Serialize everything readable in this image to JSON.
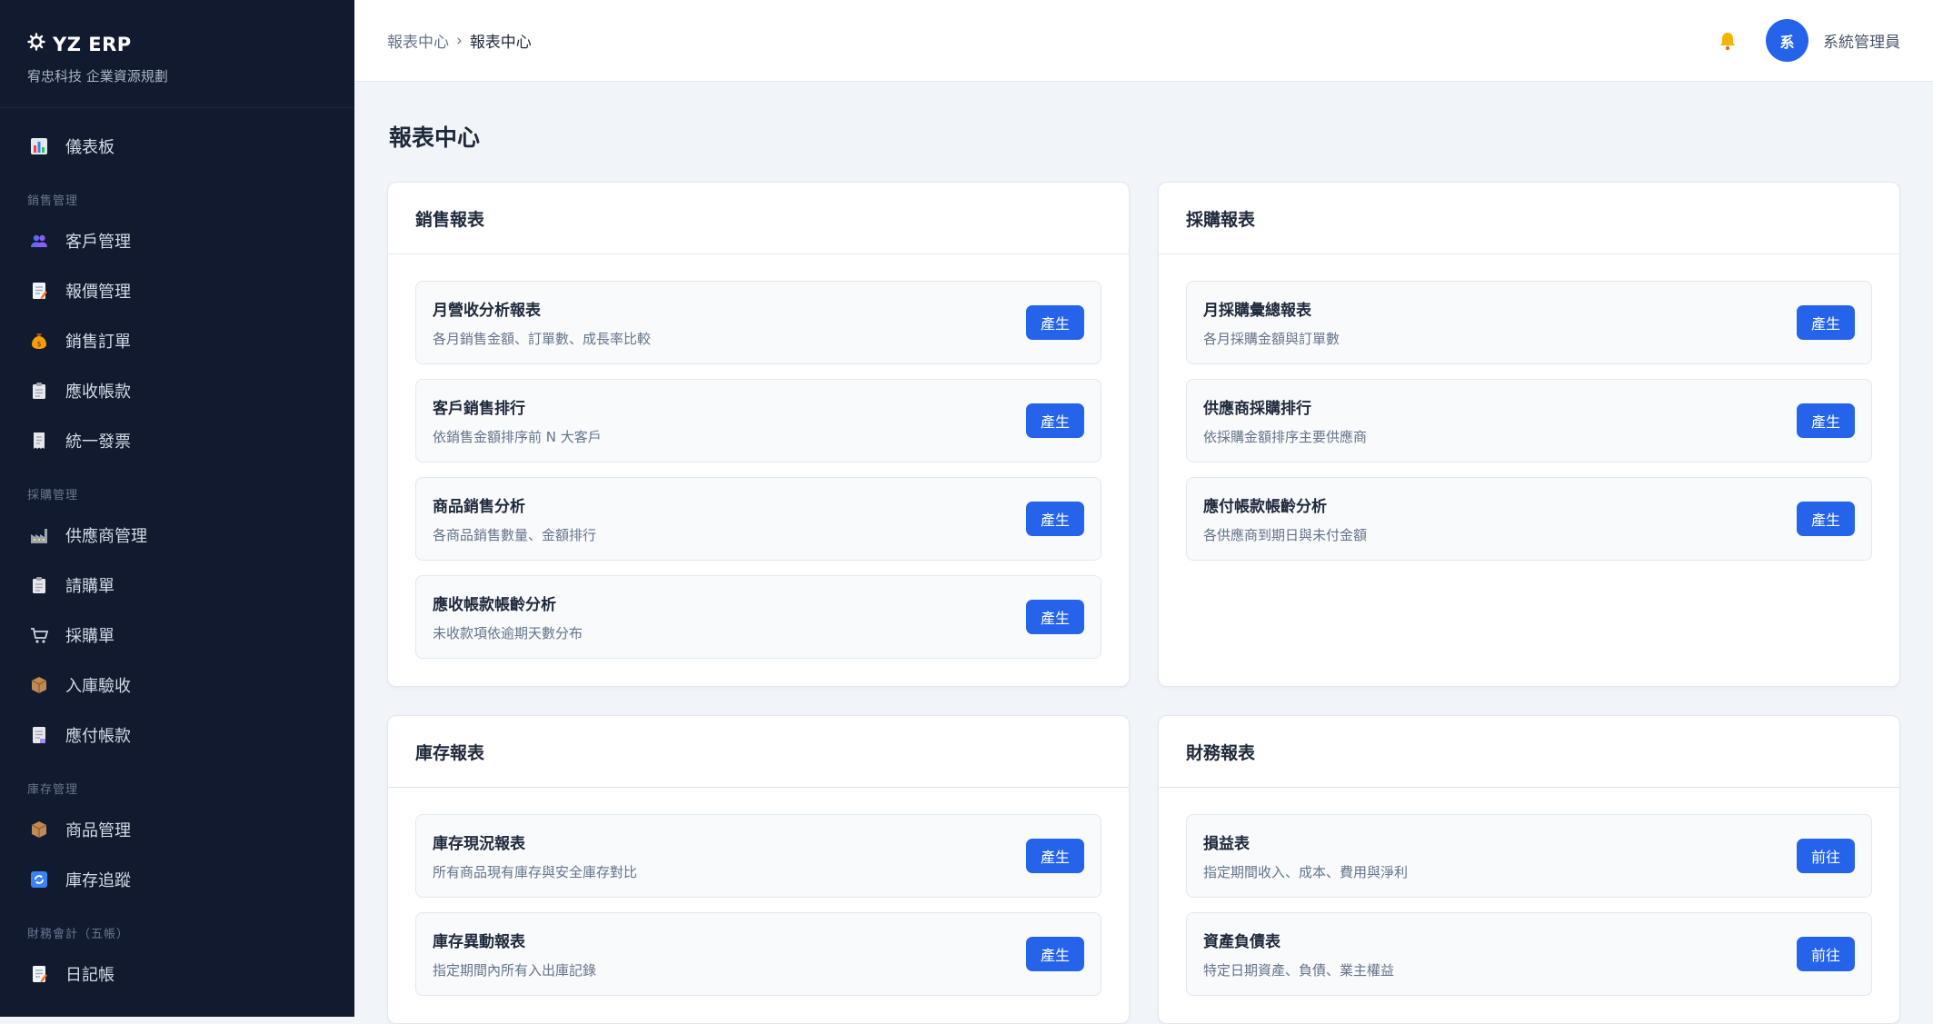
{
  "brand": {
    "title": "YZ ERP",
    "subtitle": "宥忠科技 企業資源規劃"
  },
  "sidebar": {
    "dashboard": "儀表板",
    "sales_group": "銷售管理",
    "sales": [
      "客戶管理",
      "報價管理",
      "銷售訂單",
      "應收帳款",
      "統一發票"
    ],
    "purchase_group": "採購管理",
    "purchase": [
      "供應商管理",
      "請購單",
      "採購單",
      "入庫驗收",
      "應付帳款"
    ],
    "inventory_group": "庫存管理",
    "inventory": [
      "商品管理",
      "庫存追蹤"
    ],
    "finance_group": "財務會計（五帳）",
    "finance": [
      "日記帳"
    ]
  },
  "header": {
    "breadcrumb_root": "報表中心",
    "breadcrumb_sep": "›",
    "breadcrumb_current": "報表中心",
    "avatar_initial": "系",
    "user_name": "系統管理員"
  },
  "page": {
    "title": "報表中心"
  },
  "cards": {
    "sales": {
      "title": "銷售報表",
      "items": [
        {
          "name": "月營收分析報表",
          "desc": "各月銷售金額、訂單數、成長率比較",
          "button": "產生"
        },
        {
          "name": "客戶銷售排行",
          "desc": "依銷售金額排序前 N 大客戶",
          "button": "產生"
        },
        {
          "name": "商品銷售分析",
          "desc": "各商品銷售數量、金額排行",
          "button": "產生"
        },
        {
          "name": "應收帳款帳齡分析",
          "desc": "未收款項依逾期天數分布",
          "button": "產生"
        }
      ]
    },
    "purchase": {
      "title": "採購報表",
      "items": [
        {
          "name": "月採購彙總報表",
          "desc": "各月採購金額與訂單數",
          "button": "產生"
        },
        {
          "name": "供應商採購排行",
          "desc": "依採購金額排序主要供應商",
          "button": "產生"
        },
        {
          "name": "應付帳款帳齡分析",
          "desc": "各供應商到期日與未付金額",
          "button": "產生"
        }
      ]
    },
    "inventory": {
      "title": "庫存報表",
      "items": [
        {
          "name": "庫存現況報表",
          "desc": "所有商品現有庫存與安全庫存對比",
          "button": "產生"
        },
        {
          "name": "庫存異動報表",
          "desc": "指定期間內所有入出庫記錄",
          "button": "產生"
        }
      ]
    },
    "finance": {
      "title": "財務報表",
      "items": [
        {
          "name": "損益表",
          "desc": "指定期間收入、成本、費用與淨利",
          "button": "前往"
        },
        {
          "name": "資產負債表",
          "desc": "特定日期資產、負債、業主權益",
          "button": "前往"
        }
      ]
    }
  },
  "colors": {
    "sidebar_bg": "#111a2e",
    "accent": "#2563eb",
    "page_bg": "#f1f5f9"
  }
}
